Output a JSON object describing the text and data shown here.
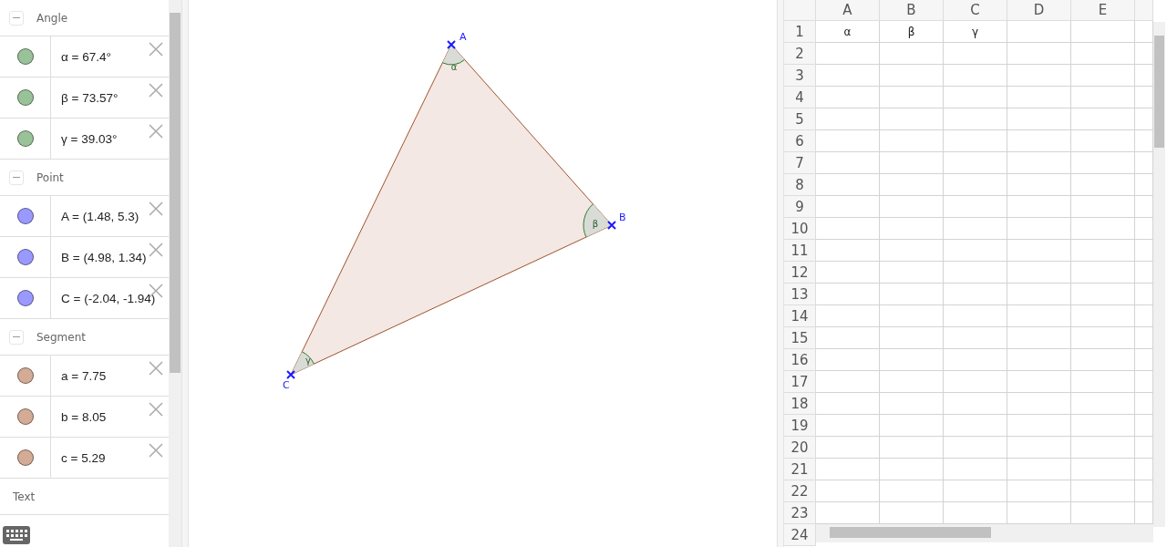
{
  "algebra": {
    "groups": [
      {
        "title": "Angle",
        "expanded": true,
        "items": [
          {
            "text": "α = 67.4°",
            "color": "#99c299"
          },
          {
            "text": "β = 73.57°",
            "color": "#99c299"
          },
          {
            "text": "γ = 39.03°",
            "color": "#99c299"
          }
        ]
      },
      {
        "title": "Point",
        "expanded": true,
        "items": [
          {
            "text": "A = (1.48, 5.3)",
            "color": "#9999ff"
          },
          {
            "text": "B = (4.98, 1.34)",
            "color": "#9999ff"
          },
          {
            "text": "C = (-2.04, -1.94)",
            "color": "#9999ff"
          }
        ]
      },
      {
        "title": "Segment",
        "expanded": true,
        "items": [
          {
            "text": "a = 7.75",
            "color": "#d4ab95"
          },
          {
            "text": "b = 8.05",
            "color": "#d4ab95"
          },
          {
            "text": "c = 5.29",
            "color": "#d4ab95"
          }
        ]
      },
      {
        "title": "Text"
      }
    ]
  },
  "graphics": {
    "points": [
      {
        "label": "A"
      },
      {
        "label": "B"
      },
      {
        "label": "C"
      }
    ],
    "angles": [
      {
        "label": "α"
      },
      {
        "label": "β"
      },
      {
        "label": "γ"
      }
    ]
  },
  "spreadsheet": {
    "columns": [
      "A",
      "B",
      "C",
      "D",
      "E"
    ],
    "rows": [
      {
        "number": "1",
        "cells": [
          "α",
          "β",
          "γ"
        ]
      },
      {
        "number": "2"
      },
      {
        "number": "3"
      },
      {
        "number": "4"
      },
      {
        "number": "5"
      },
      {
        "number": "6"
      },
      {
        "number": "7"
      },
      {
        "number": "8"
      },
      {
        "number": "9"
      },
      {
        "number": "10"
      },
      {
        "number": "11"
      },
      {
        "number": "12"
      },
      {
        "number": "13"
      },
      {
        "number": "14"
      },
      {
        "number": "15"
      },
      {
        "number": "16"
      },
      {
        "number": "17"
      },
      {
        "number": "18"
      },
      {
        "number": "19"
      },
      {
        "number": "20"
      },
      {
        "number": "21"
      },
      {
        "number": "22"
      },
      {
        "number": "23"
      },
      {
        "number": "24"
      }
    ]
  }
}
